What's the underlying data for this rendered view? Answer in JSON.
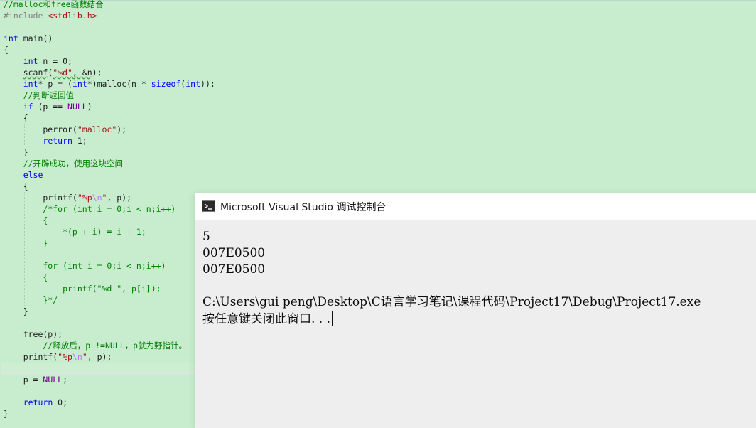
{
  "editor": {
    "lines": [
      "//malloc和free函数结合",
      "#include <stdlib.h>",
      "",
      "int main()",
      "{",
      "    int n = 0;",
      "    scanf(\"%d\", &n);",
      "    int* p = (int*)malloc(n * sizeof(int));",
      "    //判断返回值",
      "    if (p == NULL)",
      "    {",
      "        perror(\"malloc\");",
      "        return 1;",
      "    }",
      "    //开辟成功，使用这块空间",
      "    else",
      "    {",
      "        printf(\"%p\\n\", p);",
      "        /*for (int i = 0;i < n;i++)",
      "        {",
      "            *(p + i) = i + 1;",
      "        }",
      "",
      "        for (int i = 0;i < n;i++)",
      "        {",
      "            printf(\"%d \", p[i]);",
      "        }*/",
      "    }",
      "",
      "    free(p);",
      "    //释放后，p !=NULL，p就为野指针。",
      "    printf(\"%p\\n\", p);",
      "",
      "    p = NULL;",
      "",
      "    return 0;",
      "}"
    ]
  },
  "console": {
    "title": "Microsoft Visual Studio 调试控制台",
    "icon": "terminal-icon",
    "output": [
      "5",
      "007E0500",
      "007E0500",
      "",
      "C:\\Users\\gui peng\\Desktop\\C语言学习笔记\\课程代码\\Project17\\Debug\\Project17.exe",
      "按任意键关闭此窗口. . ."
    ]
  },
  "colors": {
    "editor_bg": "#c8ecce",
    "keyword": "#0000ff",
    "comment": "#008000",
    "string": "#a31515",
    "macro": "#6f008a",
    "preprocessor": "#808080"
  }
}
